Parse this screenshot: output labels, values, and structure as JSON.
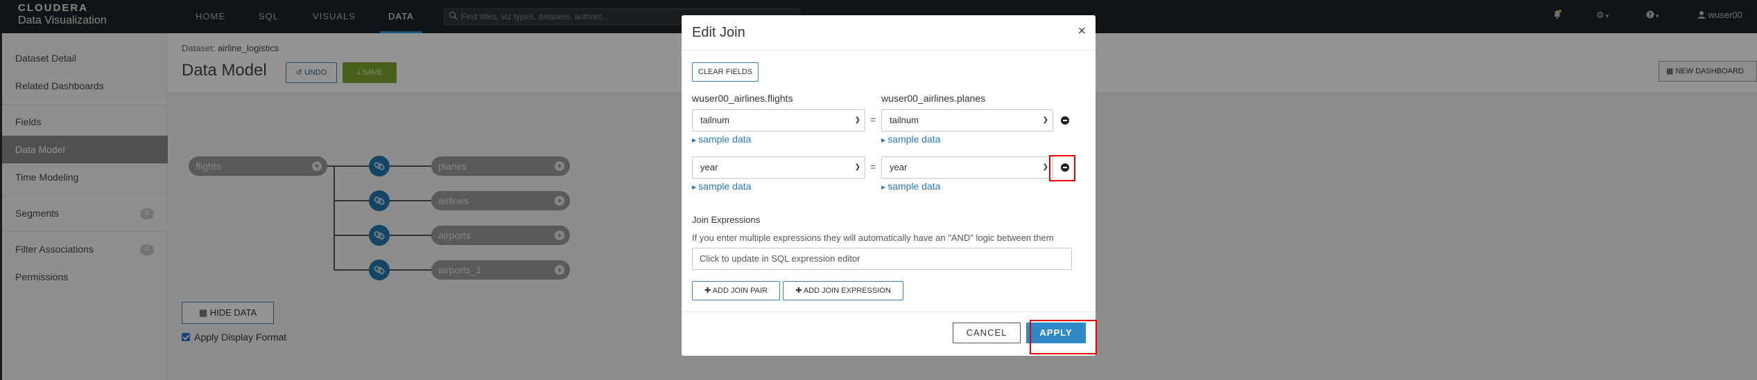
{
  "app": {
    "brand_line1": "CLOUDERA",
    "brand_line2": "Data Visualization"
  },
  "nav": {
    "tabs": [
      "HOME",
      "SQL",
      "VISUALS",
      "DATA"
    ],
    "active_tab": "DATA",
    "search_placeholder": "Find titles, viz types, datasets, authors...",
    "user": "wuser00"
  },
  "sidebar": {
    "items": [
      {
        "label": "Dataset Detail"
      },
      {
        "label": "Related Dashboards"
      },
      {
        "label": "Fields"
      },
      {
        "label": "Data Model",
        "active": true
      },
      {
        "label": "Time Modeling"
      },
      {
        "label": "Segments",
        "badge": "0"
      },
      {
        "label": "Filter Associations",
        "badge": "0"
      },
      {
        "label": "Permissions"
      }
    ]
  },
  "main": {
    "crumb_prefix": "Dataset:",
    "dataset_name": "airline_logistics",
    "title": "Data Model",
    "undo_label": "UNDO",
    "save_label": "SAVE",
    "new_dashboard_label": "NEW DASHBOARD",
    "hide_data_label": "HIDE DATA",
    "apply_display_format_label": "Apply Display Format",
    "apply_display_format_checked": true
  },
  "model": {
    "root": "flights",
    "children": [
      "planes",
      "airlines",
      "airports",
      "airports_1"
    ]
  },
  "modal": {
    "title": "Edit Join",
    "close_glyph": "×",
    "clear_fields_label": "CLEAR FIELDS",
    "left_table": "wuser00_airlines.flights",
    "right_table": "wuser00_airlines.planes",
    "pairs": [
      {
        "left": "tailnum",
        "right": "tailnum"
      },
      {
        "left": "year",
        "right": "year"
      }
    ],
    "equals": "=",
    "sample_data_label": "sample data",
    "join_expressions_title": "Join Expressions",
    "join_expressions_hint": "If you enter multiple expressions they will automatically have an \"AND\" logic between them",
    "expression_placeholder": "Click to update in SQL expression editor",
    "add_join_pair_label": "ADD JOIN PAIR",
    "add_join_expression_label": "ADD JOIN EXPRESSION",
    "cancel_label": "CANCEL",
    "apply_label": "APPLY"
  },
  "colors": {
    "accent": "#3188c6",
    "save_green": "#7fa531",
    "highlight": "#e00000",
    "navbar": "#1b2329"
  }
}
